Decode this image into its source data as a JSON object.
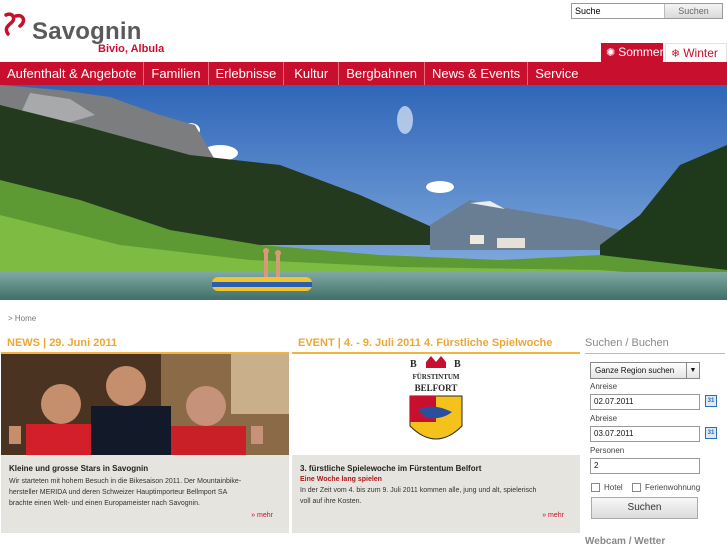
{
  "brand": {
    "name": "Savognin",
    "sub": "Bivio, Albula",
    "color": "#c8102e"
  },
  "search": {
    "value": "Suche",
    "button": "Suchen"
  },
  "season": {
    "sommer": {
      "label": "Sommer",
      "icon": "sun-icon"
    },
    "winter": {
      "label": "Winter",
      "icon": "snowflake-icon"
    }
  },
  "nav": [
    "Aufenthalt & Angebote",
    "Familien",
    "Erlebnisse",
    "Kultur",
    "Bergbahnen",
    "News & Events",
    "Service"
  ],
  "breadcrumb": "> Home",
  "news": {
    "header": "NEWS | 29. Juni 2011",
    "title": "Kleine und grosse Stars in Savognin",
    "text": "Wir starteten mit hohem Besuch in die Bikesaison 2011. Der Mountainbike-hersteller MERIDA und deren Schweizer Hauptimporteur Bellmport SA brachte einen Welt- und einen Europameister nach Savognin.",
    "more": "» mehr"
  },
  "event": {
    "header": "EVENT | 4. - 9. Juli 2011 4. Fürstliche Spielwoche",
    "logo_text": [
      "FÜRSTINTUM",
      "BELFORT"
    ],
    "title": "3. fürstliche Spielewoche im Fürstentum Belfort",
    "subtitle": "Eine Woche lang spielen",
    "text": "In der Zeit vom 4. bis zum 9. Juli 2011 kommen alle, jung und alt, spielerisch voll auf ihre Kosten.",
    "more": "» mehr"
  },
  "booking": {
    "title": "Suchen / Buchen",
    "region": "Ganze Region suchen",
    "arrival_label": "Anreise",
    "arrival": "02.07.2011",
    "departure_label": "Abreise",
    "departure": "03.07.2011",
    "persons_label": "Personen",
    "persons": "2",
    "hotel": "Hotel",
    "apartment": "Ferienwohnung",
    "submit": "Suchen"
  },
  "webcam": "Webcam / Wetter"
}
